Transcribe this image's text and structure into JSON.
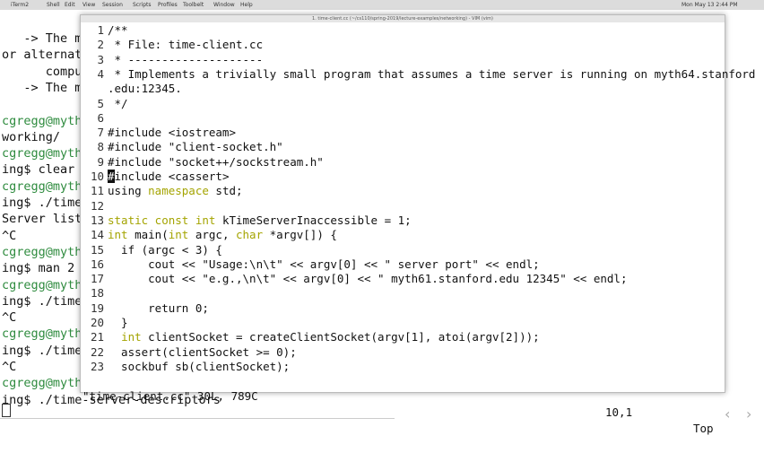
{
  "menubar": {
    "items": [
      "iTerm2",
      "Shell",
      "Edit",
      "View",
      "Session",
      "Scripts",
      "Profiles",
      "Toolbelt",
      "Window",
      "Help"
    ],
    "window_title": "1. time-client.cc (~/cs110/spring-2019/lecture-examples/networking) - VIM (vim)",
    "clock": "Mon May 13  2:44 PM"
  },
  "background_terminal": {
    "lines": [
      {
        "prompt": "",
        "text": "   -> The m"
      },
      {
        "prompt": "",
        "text": "or alternat"
      },
      {
        "prompt": "",
        "text": "      compu"
      },
      {
        "prompt": "",
        "text": "   -> The m"
      },
      {
        "prompt": "",
        "text": ""
      },
      {
        "prompt": "cgregg@myth",
        "text": ""
      },
      {
        "prompt": "",
        "text": "working/"
      },
      {
        "prompt": "cgregg@myth",
        "text": ""
      },
      {
        "prompt": "",
        "text": "ing$ clear"
      },
      {
        "prompt": "cgregg@myth",
        "text": ""
      },
      {
        "prompt": "",
        "text": "ing$ ./time"
      },
      {
        "prompt": "",
        "text": "Server list"
      },
      {
        "prompt": "",
        "text": "^C"
      },
      {
        "prompt": "cgregg@myth",
        "text": ""
      },
      {
        "prompt": "",
        "text": "ing$ man 2"
      },
      {
        "prompt": "cgregg@myth",
        "text": ""
      },
      {
        "prompt": "",
        "text": "ing$ ./time"
      },
      {
        "prompt": "",
        "text": "^C"
      },
      {
        "prompt": "cgregg@myth",
        "text": ""
      },
      {
        "prompt": "",
        "text": "ing$ ./time"
      },
      {
        "prompt": "",
        "text": "^C"
      },
      {
        "prompt": "cgregg@myth",
        "text": ""
      },
      {
        "prompt": "",
        "text": "ing$ ./time-server-descriptors"
      }
    ]
  },
  "vim": {
    "lines": [
      {
        "n": "1",
        "parts": [
          [
            "/**",
            ""
          ]
        ]
      },
      {
        "n": "2",
        "parts": [
          [
            " * File: time-client.cc",
            ""
          ]
        ]
      },
      {
        "n": "3",
        "parts": [
          [
            " * --------------------",
            ""
          ]
        ]
      },
      {
        "n": "4",
        "parts": [
          [
            " * Implements a trivially small program that assumes a time server is running on myth64.stanford",
            ""
          ]
        ]
      },
      {
        "n": "",
        "parts": [
          [
            ".edu:12345.",
            ""
          ]
        ]
      },
      {
        "n": "5",
        "parts": [
          [
            " */",
            ""
          ]
        ]
      },
      {
        "n": "6",
        "parts": [
          [
            "",
            ""
          ]
        ]
      },
      {
        "n": "7",
        "parts": [
          [
            "#include <iostream>",
            ""
          ]
        ]
      },
      {
        "n": "8",
        "parts": [
          [
            "#include \"client-socket.h\"",
            ""
          ]
        ]
      },
      {
        "n": "9",
        "parts": [
          [
            "#include \"socket++/sockstream.h\"",
            ""
          ]
        ]
      },
      {
        "n": "10",
        "parts": [
          [
            "#",
            "cursor"
          ],
          [
            "include <cassert>",
            ""
          ]
        ]
      },
      {
        "n": "11",
        "parts": [
          [
            "using ",
            ""
          ],
          [
            "namespace",
            "kw"
          ],
          [
            " std;",
            ""
          ]
        ]
      },
      {
        "n": "12",
        "parts": [
          [
            "",
            ""
          ]
        ]
      },
      {
        "n": "13",
        "parts": [
          [
            "static const int",
            "kw"
          ],
          [
            " kTimeServerInaccessible = 1;",
            ""
          ]
        ]
      },
      {
        "n": "14",
        "parts": [
          [
            "int",
            "kw"
          ],
          [
            " main(",
            ""
          ],
          [
            "int",
            "kw"
          ],
          [
            " argc, ",
            ""
          ],
          [
            "char",
            "kw"
          ],
          [
            " *argv[]) {",
            ""
          ]
        ]
      },
      {
        "n": "15",
        "parts": [
          [
            "  if (argc < 3) {",
            ""
          ]
        ]
      },
      {
        "n": "16",
        "parts": [
          [
            "      cout << \"Usage:\\n\\t\" << argv[0] << \" server port\" << endl;",
            ""
          ]
        ]
      },
      {
        "n": "17",
        "parts": [
          [
            "      cout << \"e.g.,\\n\\t\" << argv[0] << \" myth61.stanford.edu 12345\" << endl;",
            ""
          ]
        ]
      },
      {
        "n": "18",
        "parts": [
          [
            "",
            ""
          ]
        ]
      },
      {
        "n": "19",
        "parts": [
          [
            "      return 0;",
            ""
          ]
        ]
      },
      {
        "n": "20",
        "parts": [
          [
            "  }",
            ""
          ]
        ]
      },
      {
        "n": "21",
        "parts": [
          [
            "  ",
            ""
          ],
          [
            "int",
            "kw"
          ],
          [
            " clientSocket = createClientSocket(argv[1], atoi(argv[2]));",
            ""
          ]
        ]
      },
      {
        "n": "22",
        "parts": [
          [
            "  assert(clientSocket >= 0);",
            ""
          ]
        ]
      },
      {
        "n": "23",
        "parts": [
          [
            "  sockbuf sb(clientSocket);",
            ""
          ]
        ]
      }
    ],
    "status": {
      "file": "\"time-client.cc\" 30L, 789C",
      "position": "10,1",
      "scroll": "Top"
    }
  },
  "colors": {
    "prompt": "#2e8b3e",
    "keyword": "#a4a400"
  }
}
